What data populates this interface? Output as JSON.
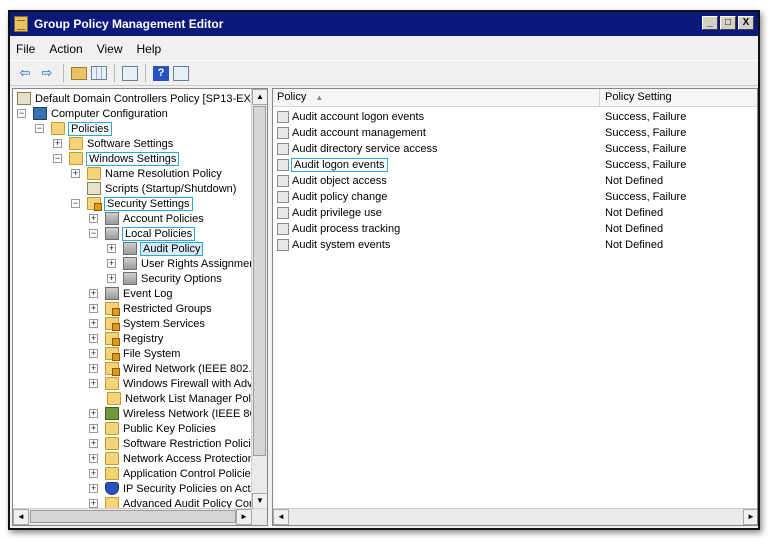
{
  "window": {
    "title": "Group Policy Management Editor",
    "controls": [
      "_",
      "□",
      "X"
    ]
  },
  "menu": [
    "File",
    "Action",
    "View",
    "Help"
  ],
  "toolbar": [
    "back-icon",
    "forward-icon",
    "up-folder-icon",
    "show-hide-tree-icon",
    "export-list-icon",
    "help-icon",
    "properties-icon"
  ],
  "tree": {
    "root": "Default Domain Controllers Policy [SP13-EX10.",
    "computer_configuration": "Computer Configuration",
    "policies": "Policies",
    "software_settings": "Software Settings",
    "windows_settings": "Windows Settings",
    "name_resolution_policy": "Name Resolution Policy",
    "scripts": "Scripts (Startup/Shutdown)",
    "security_settings": "Security Settings",
    "account_policies": "Account Policies",
    "local_policies": "Local Policies",
    "audit_policy": "Audit Policy",
    "user_rights": "User Rights Assignmer",
    "security_options": "Security Options",
    "event_log": "Event Log",
    "restricted_groups": "Restricted Groups",
    "system_services": "System Services",
    "registry": "Registry",
    "file_system": "File System",
    "wired_network": "Wired Network (IEEE 802.",
    "windows_firewall": "Windows Firewall with Adv",
    "network_list_manager": "Network List Manager Polic",
    "wireless_network": "Wireless Network (IEEE 8C",
    "public_key_policies": "Public Key Policies",
    "software_restriction": "Software Restriction Polici",
    "network_access_protection": "Network Access Protection",
    "application_control": "Application Control Policies",
    "ip_security": "IP Security Policies on Acti",
    "advanced_audit": "Advanced Audit Policy Cor"
  },
  "list": {
    "col_policy": "Policy",
    "col_setting": "Policy Setting",
    "rows": [
      {
        "policy": "Audit account logon events",
        "setting": "Success, Failure"
      },
      {
        "policy": "Audit account management",
        "setting": "Success, Failure"
      },
      {
        "policy": "Audit directory service access",
        "setting": "Success, Failure"
      },
      {
        "policy": "Audit logon events",
        "setting": "Success, Failure"
      },
      {
        "policy": "Audit object access",
        "setting": "Not Defined"
      },
      {
        "policy": "Audit policy change",
        "setting": "Success, Failure"
      },
      {
        "policy": "Audit privilege use",
        "setting": "Not Defined"
      },
      {
        "policy": "Audit process tracking",
        "setting": "Not Defined"
      },
      {
        "policy": "Audit system events",
        "setting": "Not Defined"
      }
    ]
  }
}
